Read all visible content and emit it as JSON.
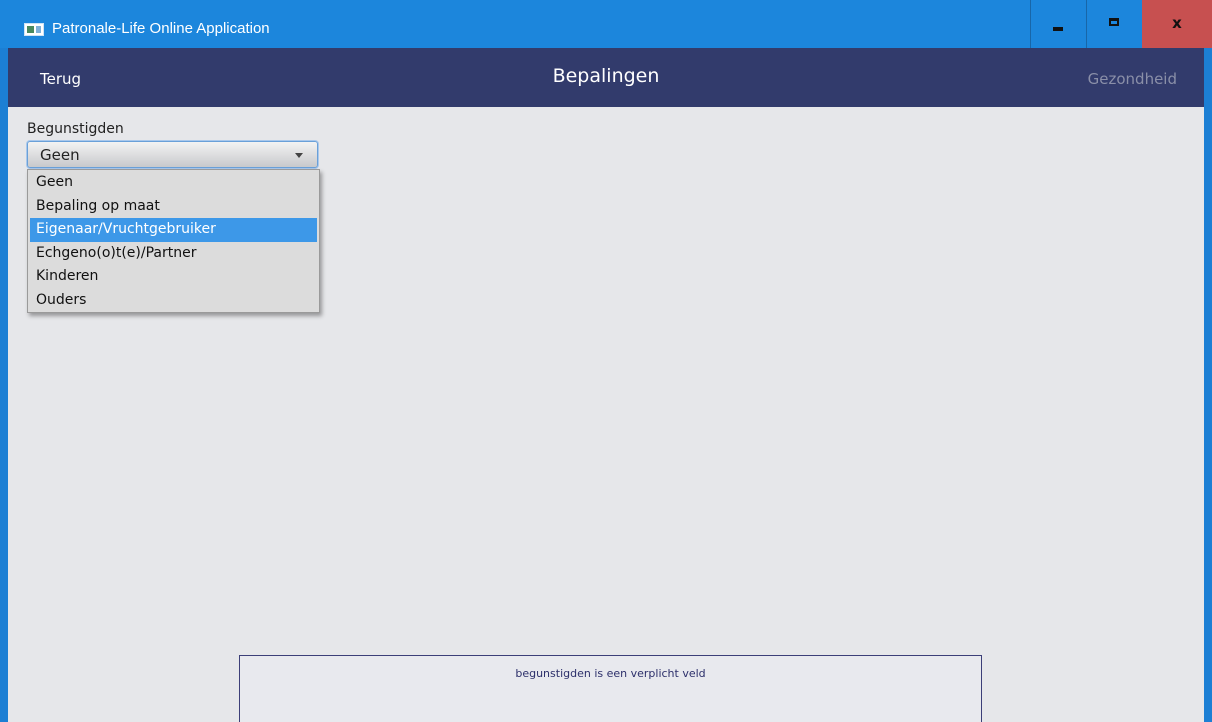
{
  "window": {
    "title": "Patronale-Life Online Application",
    "close_label": "x"
  },
  "header": {
    "back_label": "Terug",
    "title": "Bepalingen",
    "next_label": "Gezondheid"
  },
  "form": {
    "field_label": "Begunstigden",
    "combo_value": "Geen",
    "options": [
      {
        "label": "Geen"
      },
      {
        "label": "Bepaling op maat"
      },
      {
        "label": "Eigenaar/Vruchtgebruiker"
      },
      {
        "label": "Echgeno(o)t(e)/Partner"
      },
      {
        "label": "Kinderen"
      },
      {
        "label": "Ouders"
      }
    ],
    "highlighted_option": "Eigenaar/Vruchtgebruiker"
  },
  "validation": {
    "message": "begunstigden is een verplicht veld"
  },
  "colors": {
    "titlebar": "#1c86dc",
    "header": "#323b6c",
    "close_button": "#c75050",
    "selection": "#3d98e8",
    "background": "#e6e7ea"
  }
}
